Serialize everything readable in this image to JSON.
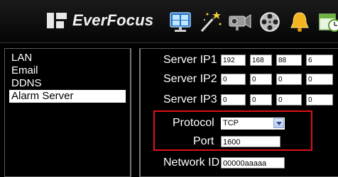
{
  "header": {
    "brand": "EverFocus",
    "icons": [
      "network-icon",
      "magic-wand-icon",
      "camera-icon",
      "film-reel-icon",
      "bell-icon",
      "schedule-icon"
    ]
  },
  "sidebar": {
    "items": [
      {
        "label": "LAN",
        "active": false
      },
      {
        "label": "Email",
        "active": false
      },
      {
        "label": "DDNS",
        "active": false
      },
      {
        "label": "Alarm Server",
        "active": true
      }
    ]
  },
  "form": {
    "server_ip1": {
      "label": "Server IP1",
      "octets": [
        "192",
        "168",
        "88",
        "6"
      ]
    },
    "server_ip2": {
      "label": "Server IP2",
      "octets": [
        "0",
        "0",
        "0",
        "0"
      ]
    },
    "server_ip3": {
      "label": "Server IP3",
      "octets": [
        "0",
        "0",
        "0",
        "0"
      ]
    },
    "protocol": {
      "label": "Protocol",
      "value": "TCP"
    },
    "port": {
      "label": "Port",
      "value": "1600"
    },
    "network_id": {
      "label": "Network ID",
      "value": "00000aaaaa"
    }
  },
  "colors": {
    "highlight": "#e0101a",
    "active_bg": "#ffffff",
    "background": "#000000"
  }
}
